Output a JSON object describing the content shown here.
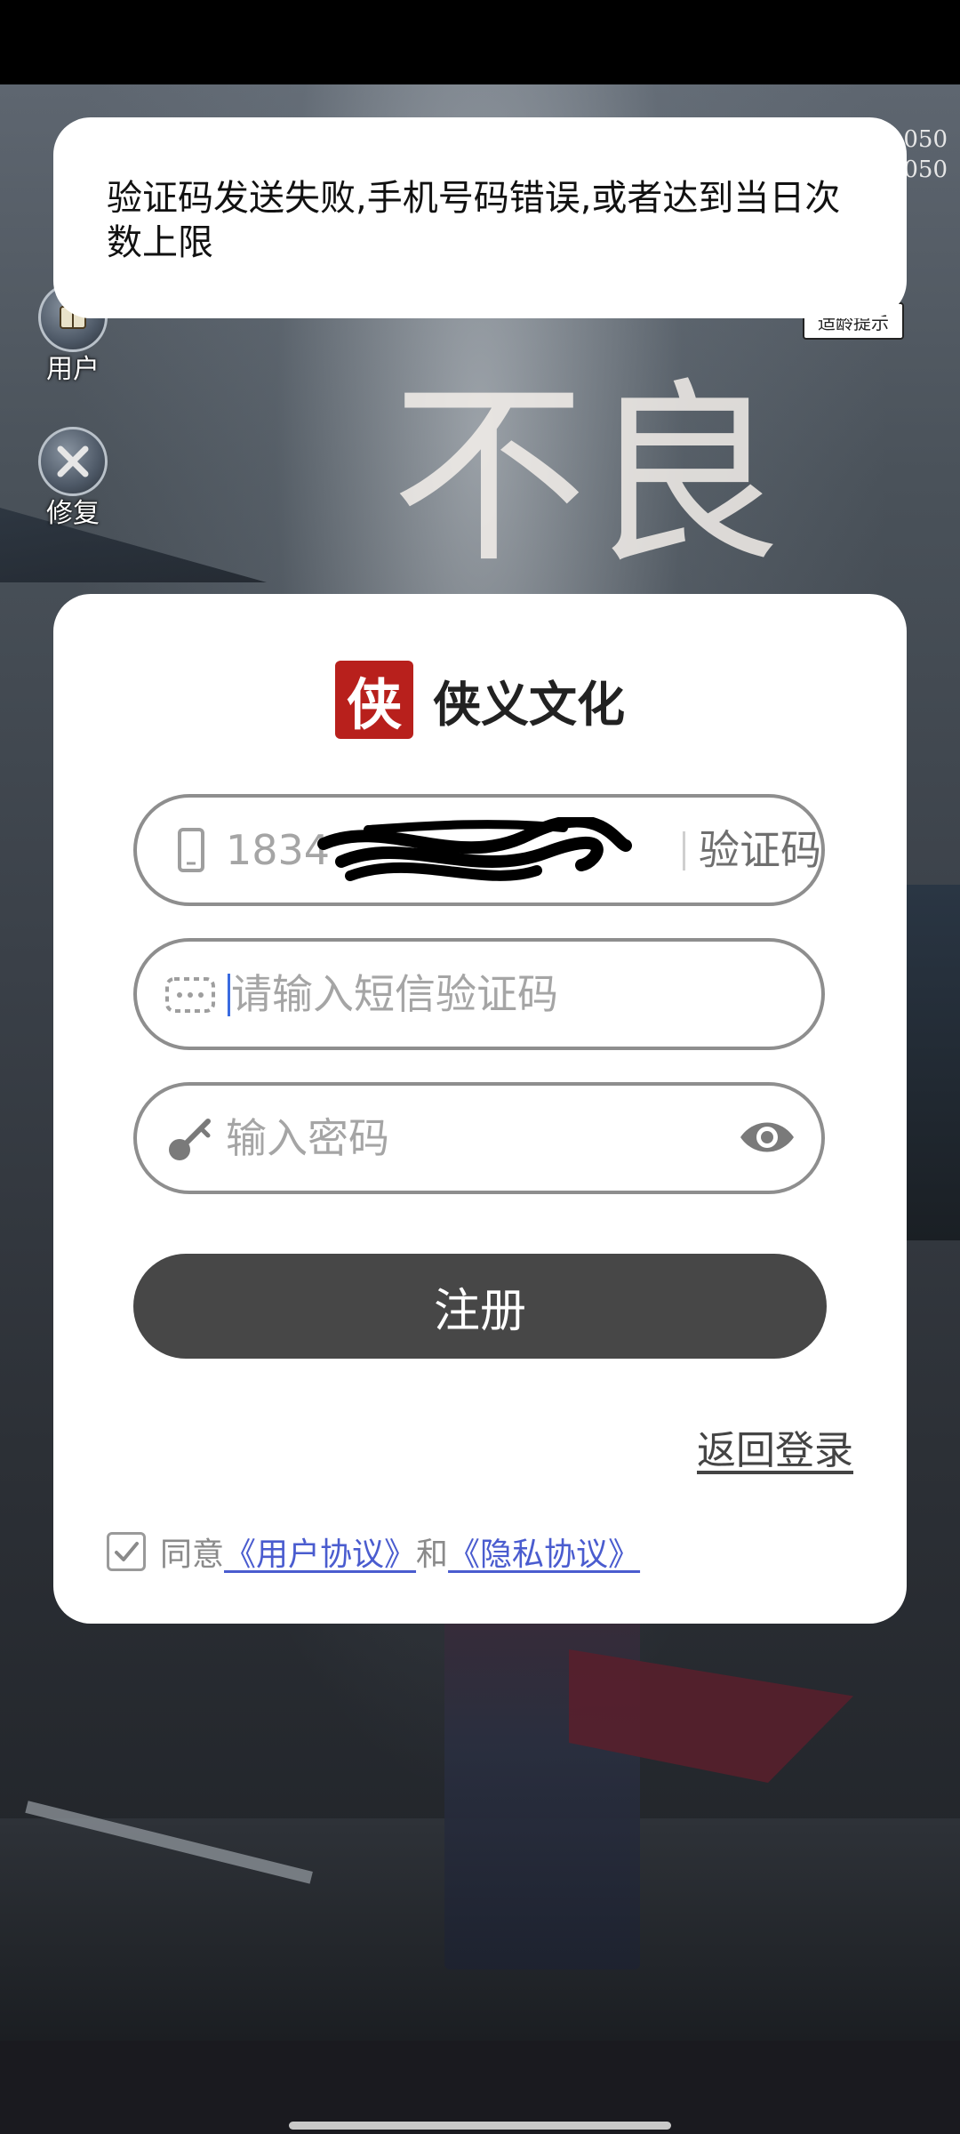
{
  "toast": {
    "message": "验证码发送失败,手机号码错误,或者达到当日次数上限"
  },
  "background": {
    "version_line1": "050",
    "version_line2": "050",
    "age_badge": "适龄提示",
    "calligraphy": "不良"
  },
  "side_buttons": [
    {
      "label": "用户",
      "icon": "user-book-icon"
    },
    {
      "label": "修复",
      "icon": "repair-tools-icon"
    }
  ],
  "brand": {
    "seal_char": "侠",
    "name": "侠义文化"
  },
  "form": {
    "phone_value": "1834",
    "get_code_label": "验证码",
    "sms_placeholder": "请输入短信验证码",
    "password_placeholder": "输入密码",
    "register_label": "注册",
    "back_login_label": "返回登录"
  },
  "agreement": {
    "checked": true,
    "prefix": "同意",
    "user_agreement": "《用户协议》",
    "conjunction": "和",
    "privacy_agreement": "《隐私协议》"
  },
  "colors": {
    "button_bg": "#474747",
    "link": "#4a5ccf",
    "seal_red": "#b8201c"
  }
}
